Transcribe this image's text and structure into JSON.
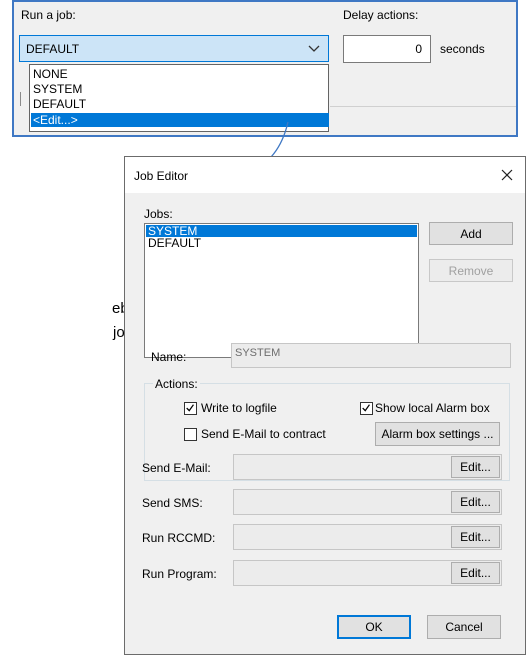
{
  "top": {
    "run_job_label": "Run a job:",
    "job_selected": "DEFAULT",
    "delay_label": "Delay actions:",
    "delay_value": "0",
    "seconds_label": "seconds",
    "dropdown_options": [
      "NONE",
      "SYSTEM",
      "DEFAULT",
      "<Edit...>"
    ],
    "dropdown_highlighted": "<Edit...>"
  },
  "side_text": [
    "eby",
    "job"
  ],
  "dialog": {
    "title": "Job Editor",
    "jobs_label": "Jobs:",
    "jobs": [
      "SYSTEM",
      "DEFAULT"
    ],
    "selected_job": "SYSTEM",
    "add_label": "Add",
    "remove_label": "Remove",
    "name_label": "Name:",
    "name_value": "SYSTEM",
    "actions_label": "Actions:",
    "write_logfile_label": "Write to logfile",
    "write_logfile_checked": true,
    "show_alarm_label": "Show local Alarm box",
    "show_alarm_checked": true,
    "send_email_contract_label": "Send E-Mail to contract",
    "send_email_contract_checked": false,
    "alarm_settings_label": "Alarm box settings ...",
    "send_email_label": "Send E-Mail:",
    "send_sms_label": "Send SMS:",
    "run_rccmd_label": "Run RCCMD:",
    "run_program_label": "Run Program:",
    "edit_label": "Edit...",
    "ok_label": "OK",
    "cancel_label": "Cancel"
  },
  "colors": {
    "accent": "#0078d7",
    "panel_border": "#3f78c4",
    "arrow": "#3f78c4"
  }
}
